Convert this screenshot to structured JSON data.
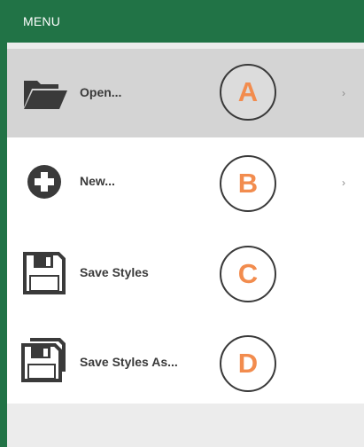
{
  "menu": {
    "title": "MENU",
    "items": [
      {
        "label": "Open...",
        "badge": "A",
        "icon": "folder-icon",
        "has_submenu": true
      },
      {
        "label": "New...",
        "badge": "B",
        "icon": "plus-circle-icon",
        "has_submenu": true
      },
      {
        "label": "Save Styles",
        "badge": "C",
        "icon": "floppy-disk-icon",
        "has_submenu": false
      },
      {
        "label": "Save Styles As...",
        "badge": "D",
        "icon": "floppy-disk-multi-icon",
        "has_submenu": false
      }
    ],
    "chevron_glyph": "›"
  },
  "colors": {
    "header_bg": "#217346",
    "selected_bg": "#d4d4d4",
    "badge_text": "#f28c4e"
  }
}
